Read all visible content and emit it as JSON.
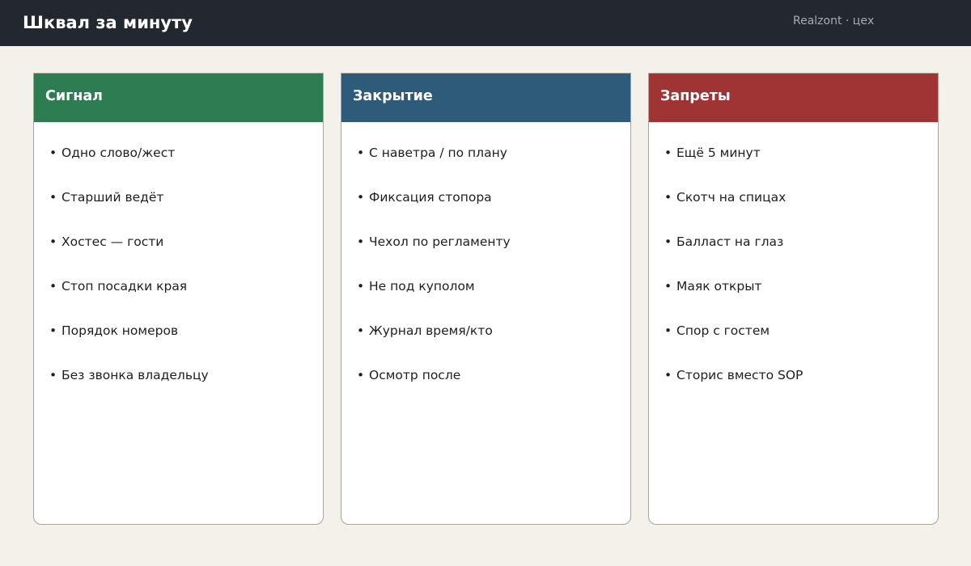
{
  "header": {
    "title": "Шквал за минуту",
    "tag": "Realzont · цех"
  },
  "columns": [
    {
      "title": "Сигнал",
      "color": "#2e7d52",
      "items": [
        "Одно слово/жест",
        "Старший ведёт",
        "Хостес — гости",
        "Стоп посадки края",
        "Порядок номеров",
        "Без звонка владельцу"
      ]
    },
    {
      "title": "Закрытие",
      "color": "#2e5b7a",
      "items": [
        "С наветра / по плану",
        "Фиксация стопора",
        "Чехол по регламенту",
        "Не под куполом",
        "Журнал время/кто",
        "Осмотр после"
      ]
    },
    {
      "title": "Запреты",
      "color": "#a03333",
      "items": [
        "Ещё 5 минут",
        "Скотч на спицах",
        "Балласт на глаз",
        "Маяк открыт",
        "Спор с гостем",
        "Сторис вместо SOP"
      ]
    }
  ],
  "bullet": "•"
}
